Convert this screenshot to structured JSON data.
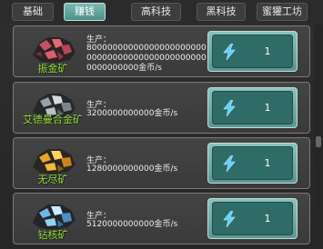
{
  "tabs": [
    {
      "label": "基础",
      "active": false
    },
    {
      "label": "赚钱",
      "active": true
    },
    {
      "label": "高科技",
      "active": false
    },
    {
      "label": "黑科技",
      "active": false
    },
    {
      "label": "蜜獾工坊",
      "active": false
    }
  ],
  "rows": [
    {
      "ore_name": "振金矿",
      "ore_icon": "vibranium-ore-icon",
      "prod_label": "生产：",
      "prod_value": "80000000000000000000000000000000000000000000000000000000金币/s",
      "count": "1",
      "button_icon": "lightning-icon"
    },
    {
      "ore_name": "艾德曼合金矿",
      "ore_icon": "adamantium-ore-icon",
      "prod_label": "生产：",
      "prod_value": "3200000000000金币/s",
      "count": "1",
      "button_icon": "lightning-icon"
    },
    {
      "ore_name": "无尽矿",
      "ore_icon": "infinity-ore-icon",
      "prod_label": "生产：",
      "prod_value": "1280000000000金币/s",
      "count": "1",
      "button_icon": "lightning-icon"
    },
    {
      "ore_name": "钻核矿",
      "ore_icon": "diamond-core-ore-icon",
      "prod_label": "生产：",
      "prod_value": "5120000000000金币/s",
      "count": "1",
      "button_icon": "lightning-icon"
    }
  ],
  "colors": {
    "active_tab": "#5f9f98",
    "ore_label": "#9fe04b",
    "button": "#2f6b67"
  }
}
